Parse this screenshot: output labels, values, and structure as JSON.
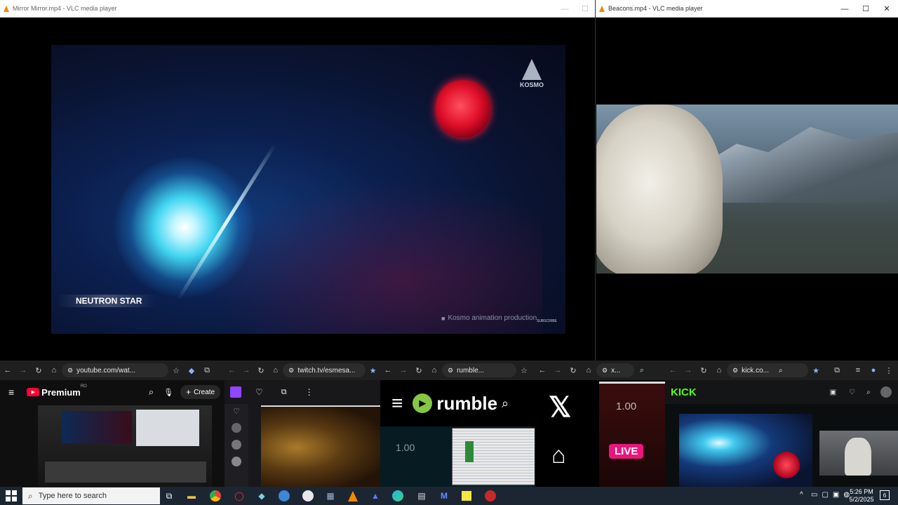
{
  "vlc_left": {
    "title": "Mirror Mirror.mp4 - VLC media player",
    "overlay_label": "NEUTRON STAR",
    "logo_text": "KOSMO",
    "credit": "Kosmo animation production",
    "subscribe": "SUBSCRIBE"
  },
  "vlc_right": {
    "title": "Beacons.mp4 - VLC media player"
  },
  "youtube": {
    "url": "youtube.com/wat...",
    "brand": "Premium",
    "region": "RO",
    "create_label": "Create"
  },
  "twitch": {
    "url": "twitch.tv/esmesa..."
  },
  "rumble": {
    "url": "rumble...",
    "brand": "rumble",
    "speed": "1.00"
  },
  "xpanel": {
    "url": "x...",
    "speed": "1.00",
    "live": "LIVE"
  },
  "kick": {
    "url": "kick.co...",
    "brand": "KICK"
  },
  "taskbar": {
    "search_placeholder": "Type here to search",
    "time": "5:26 PM",
    "date": "5/2/2025",
    "notif_count": "6"
  },
  "colors": {
    "vlc_orange": "#f08a00",
    "kick_green": "#53fc18",
    "rumble_green": "#85c742",
    "twitch_purple": "#9146ff",
    "youtube_red": "#ff0033",
    "live_pink": "#e9167d"
  }
}
